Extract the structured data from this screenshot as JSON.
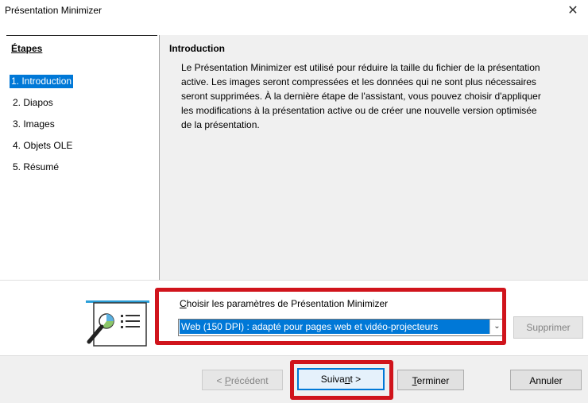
{
  "window": {
    "title": "Présentation Minimizer",
    "close_glyph": "✕"
  },
  "steps": {
    "title": "Étapes",
    "items": [
      {
        "label": "1. Introduction",
        "active": true
      },
      {
        "label": "2. Diapos",
        "active": false
      },
      {
        "label": "3. Images",
        "active": false
      },
      {
        "label": "4. Objets OLE",
        "active": false
      },
      {
        "label": "5. Résumé",
        "active": false
      }
    ]
  },
  "content": {
    "title": "Introduction",
    "body_lines": [
      "Le Présentation Minimizer est utilisé pour réduire la taille du fichier de la présentation",
      "active. Les images seront compressées et les données qui ne sont plus nécessaires",
      "seront supprimées. À la dernière étape de l'assistant, vous pouvez choisir d'appliquer",
      "les modifications à la présentation active ou de créer une nouvelle version optimisée",
      "de la présentation."
    ]
  },
  "settings": {
    "label_mnemonic": "C",
    "label_rest": "hoisir les paramètres de Présentation Minimizer",
    "selected": "Web (150 DPI) : adapté pour pages web et vidéo-projecteurs",
    "delete_label": "Supprimer"
  },
  "buttons": {
    "prev_pre": "< ",
    "prev_mn": "P",
    "prev_post": "récédent",
    "next_pre": "Suiva",
    "next_mn": "n",
    "next_post": "t >",
    "finish_mn": "T",
    "finish_post": "erminer",
    "cancel": "Annuler"
  },
  "icons": {
    "wizard": "presentation-chart-magnifier-icon",
    "dropdown": "chevron-down-icon"
  },
  "colors": {
    "selection": "#0078d7",
    "highlight": "#d0141c",
    "panel": "#f0f0f0"
  }
}
